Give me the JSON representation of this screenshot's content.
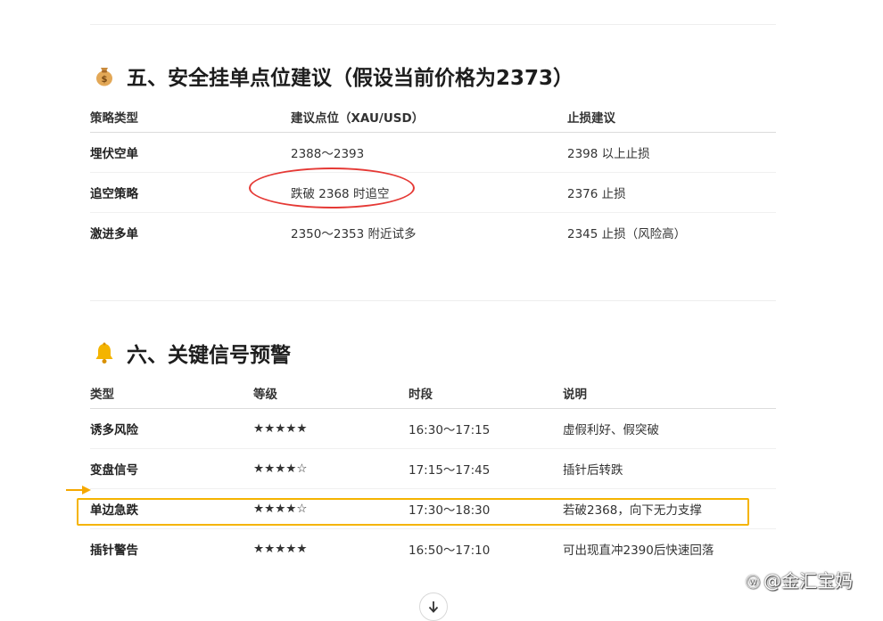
{
  "section5": {
    "title": "五、安全挂单点位建议（假设当前价格为2373）",
    "icon": "money-bag-icon",
    "headers": [
      "策略类型",
      "建议点位（XAU/USD）",
      "止损建议"
    ],
    "rows": [
      [
        "埋伏空单",
        "2388～2393",
        "2398 以上止损"
      ],
      [
        "追空策略",
        "跌破 2368 时追空",
        "2376 止损"
      ],
      [
        "激进多单",
        "2350～2353 附近试多",
        "2345 止损（风险高）"
      ]
    ]
  },
  "section6": {
    "title": "六、关键信号预警",
    "icon": "bell-icon",
    "headers": [
      "类型",
      "等级",
      "时段",
      "说明"
    ],
    "rows": [
      [
        "诱多风险",
        "★★★★★",
        "16:30～17:15",
        "虚假利好、假突破"
      ],
      [
        "变盘信号",
        "★★★★☆",
        "17:15～17:45",
        "插针后转跌"
      ],
      [
        "单边急跌",
        "★★★★☆",
        "17:30～18:30",
        "若破2368，向下无力支撑"
      ],
      [
        "插针警告",
        "★★★★★",
        "16:50～17:10",
        "可出现直冲2390后快速回落"
      ]
    ]
  },
  "watermark": "@金汇宝妈",
  "colors": {
    "annotation_oval": "#e53935",
    "highlight_box": "#f5b400"
  }
}
